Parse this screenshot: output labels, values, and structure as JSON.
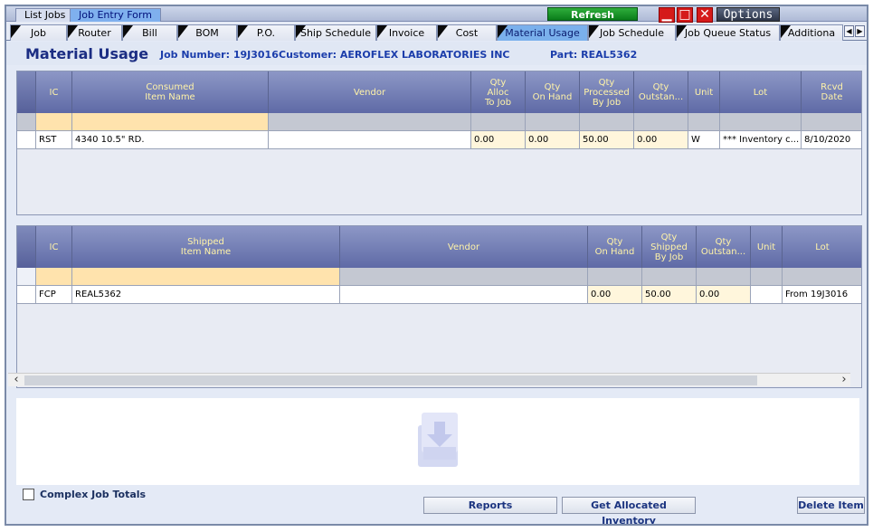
{
  "top_tabs": [
    {
      "label": "List Jobs"
    },
    {
      "label": "Job Entry Form"
    }
  ],
  "refresh_label": "Refresh",
  "options_label": "Options",
  "window_buttons": {
    "minimize": "▁",
    "maximize": "□",
    "close": "✕"
  },
  "module_tabs": [
    "Job",
    "Router",
    "Bill",
    "BOM",
    "P.O.",
    "Ship Schedule",
    "Invoice",
    "Cost",
    "Material Usage",
    "Job Schedule",
    "Job Queue Status",
    "Additiona"
  ],
  "active_module_tab": "Material Usage",
  "header": {
    "title": "Material Usage",
    "job_number": "Job Number: 19J3016",
    "customer": "Customer: AEROFLEX LABORATORIES INC",
    "part": "Part: REAL5362"
  },
  "consumed_grid": {
    "columns": [
      "IC",
      "Consumed\nItem Name",
      "Vendor",
      "Qty\nAlloc\nTo Job",
      "Qty\nOn Hand",
      "Qty\nProcessed\nBy Job",
      "Qty\nOutstan...",
      "Unit",
      "Lot",
      "Rcvd\nDate"
    ],
    "rows": [
      {
        "ic": "RST",
        "item": "4340 10.5\" RD.",
        "vendor": "",
        "alloc": "0.00",
        "on_hand": "0.00",
        "processed": "50.00",
        "outstanding": "0.00",
        "unit": "W",
        "lot": "*** Inventory c...",
        "rcvd": "8/10/2020"
      }
    ]
  },
  "shipped_grid": {
    "columns": [
      "IC",
      "Shipped\nItem Name",
      "Vendor",
      "Qty\nOn Hand",
      "Qty\nShipped\nBy Job",
      "Qty\nOutstan...",
      "Unit",
      "Lot"
    ],
    "rows": [
      {
        "ic": "FCP",
        "item": "REAL5362",
        "vendor": "",
        "on_hand": "0.00",
        "shipped": "50.00",
        "outstanding": "0.00",
        "unit": "",
        "lot": "From 19J3016"
      }
    ]
  },
  "complex_job_totals_label": "Complex Job Totals",
  "buttons": {
    "reports": "Reports",
    "get_allocated": "Get Allocated Inventory",
    "delete_item": "Delete Item"
  },
  "colors": {
    "header_bg": "#6b76ad",
    "header_text": "#fff3a8",
    "title": "#1b2d83",
    "info": "#1b3dab",
    "active_tab": "#7ab0ec",
    "refresh": "#0a7d1a",
    "close": "#d51a1a"
  }
}
